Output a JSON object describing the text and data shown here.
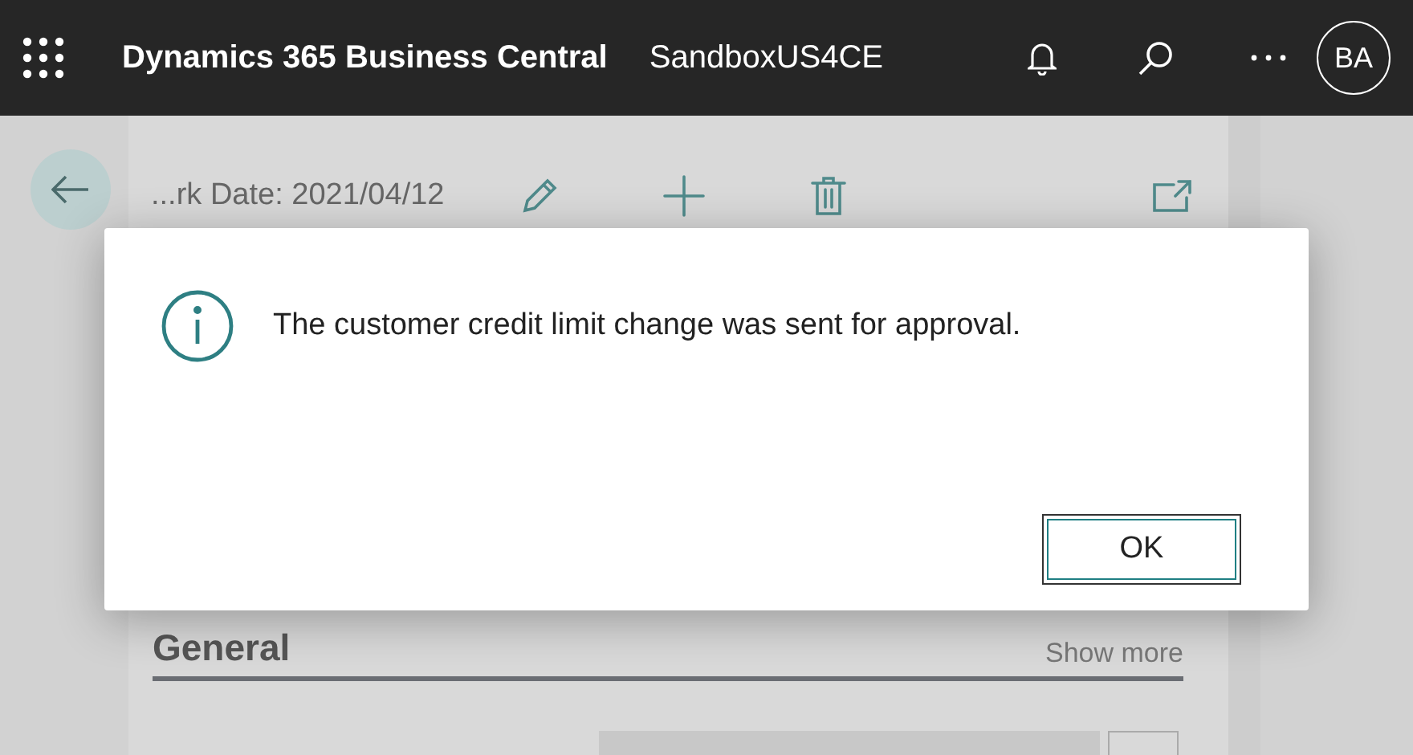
{
  "top_bar": {
    "app_title": "Dynamics 365 Business Central",
    "environment": "SandboxUS4CE",
    "avatar": "BA"
  },
  "page": {
    "title": "...rk Date: 2021/04/12",
    "section": {
      "title": "General",
      "action": "Show more"
    }
  },
  "dialog": {
    "message": "The customer credit limit change was sent for approval.",
    "buttons": [
      "OK"
    ]
  }
}
